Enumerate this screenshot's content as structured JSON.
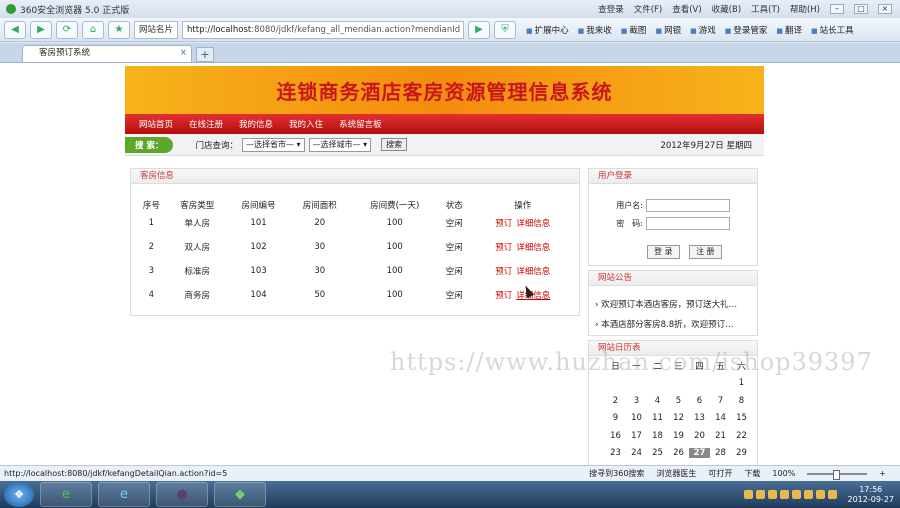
{
  "window": {
    "title": "360安全浏览器 5.0 正式版",
    "menu": [
      "查登录",
      "文件(F)",
      "查看(V)",
      "收藏(B)",
      "工具(T)",
      "帮助(H)"
    ]
  },
  "toolbar": {
    "site_label": "网站名片",
    "address_host": "http://localhost",
    "address_rest": ":8080/jdkf/kefang_all_mendian.action?mendianId",
    "links": [
      "扩展中心",
      "我来收",
      "截图",
      "网银",
      "游戏",
      "登录管家",
      "翻译",
      "站长工具"
    ]
  },
  "tab": {
    "label": "客房预订系统"
  },
  "site": {
    "banner_title": "连锁商务酒店客房资源管理信息系统",
    "menu": [
      "网站首页",
      "在线注册",
      "我的信息",
      "我的入住",
      "系统留言板"
    ],
    "search": {
      "tag": "搜 索：",
      "label": "门店查询：",
      "province_select": "—选择省市—",
      "city_select": "—选择城市—",
      "button": "搜索",
      "date": "2012年9月27日 星期四"
    },
    "rooms": {
      "heading": "客房信息",
      "columns": [
        "序号",
        "客房类型",
        "房间编号",
        "房间面积",
        "房间费(一天)",
        "状态",
        "操作"
      ],
      "rows": [
        {
          "no": "1",
          "type": "单人房",
          "room": "101",
          "area": "20",
          "price": "100",
          "status": "空闲",
          "book": "预订",
          "detail": "详细信息"
        },
        {
          "no": "2",
          "type": "双人房",
          "room": "102",
          "area": "30",
          "price": "100",
          "status": "空闲",
          "book": "预订",
          "detail": "详细信息"
        },
        {
          "no": "3",
          "type": "标准房",
          "room": "103",
          "area": "30",
          "price": "100",
          "status": "空闲",
          "book": "预订",
          "detail": "详细信息"
        },
        {
          "no": "4",
          "type": "商务房",
          "room": "104",
          "area": "50",
          "price": "100",
          "status": "空闲",
          "book": "预订",
          "detail": "详细信息"
        }
      ]
    },
    "login": {
      "heading": "用户登录",
      "user_label": "用户名:",
      "pass_label": "密　码:",
      "login_button": "登 录",
      "register_button": "注 册"
    },
    "notice": {
      "heading": "网站公告",
      "items": [
        "欢迎预订本酒店客房，预订送大礼…",
        "本酒店部分客房8.8折，欢迎预订…"
      ]
    },
    "calendar": {
      "heading": "网站日历表",
      "weekdays": [
        "日",
        "一",
        "二",
        "三",
        "四",
        "五",
        "六"
      ],
      "weeks": [
        [
          "",
          "",
          "",
          "",
          "",
          "",
          "1"
        ],
        [
          "2",
          "3",
          "4",
          "5",
          "6",
          "7",
          "8"
        ],
        [
          "9",
          "10",
          "11",
          "12",
          "13",
          "14",
          "15"
        ],
        [
          "16",
          "17",
          "18",
          "19",
          "20",
          "21",
          "22"
        ],
        [
          "23",
          "24",
          "25",
          "26",
          "27",
          "28",
          "29"
        ]
      ],
      "today": "27"
    }
  },
  "watermark": "https://www.huzhan.com/ishop39397",
  "status": {
    "url": "http://localhost:8080/jdkf/kefangDetailQian.action?id=5",
    "items": [
      "搜寻到360搜索",
      "浏览器医生",
      "可打开",
      "下载"
    ],
    "zoom": "100%"
  },
  "taskbar": {
    "time": "17:56",
    "date": "2012-09-27"
  }
}
